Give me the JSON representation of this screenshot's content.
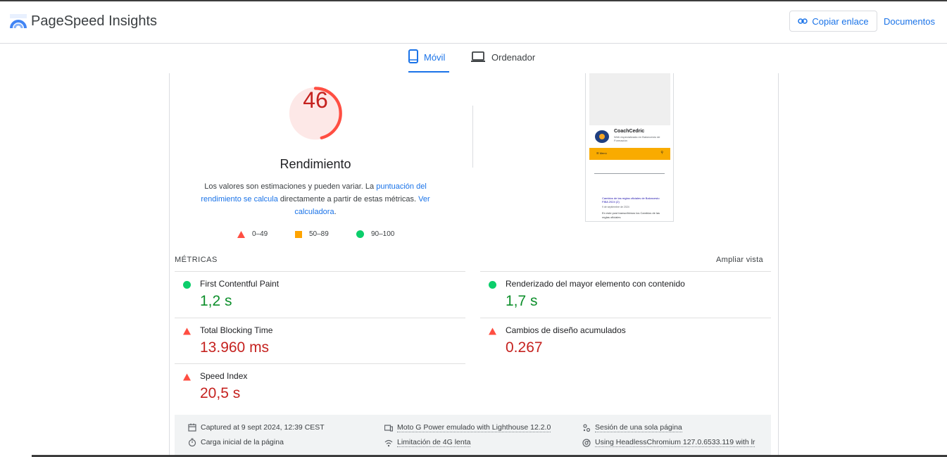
{
  "header": {
    "app_title": "PageSpeed Insights",
    "copy_link_label": "Copiar enlace",
    "docs_label": "Documentos"
  },
  "tabs": [
    {
      "label": "Móvil",
      "icon": "phone-icon",
      "selected": true
    },
    {
      "label": "Ordenador",
      "icon": "laptop-icon",
      "selected": false
    }
  ],
  "performance": {
    "score": "46",
    "score_fraction": 0.46,
    "title": "Rendimiento",
    "desc_prefix": "Los valores son estimaciones y pueden variar. La ",
    "desc_link1": "puntuación del rendimiento se calcula",
    "desc_middle": " directamente a partir de estas métricas. ",
    "desc_link2": "Ver calculadora",
    "desc_suffix": "."
  },
  "legend": [
    {
      "label": "0–49",
      "shape": "triangle",
      "color": "#ff4e42"
    },
    {
      "label": "50–89",
      "shape": "square",
      "color": "#ffa400"
    },
    {
      "label": "90–100",
      "shape": "circle",
      "color": "#0cce6b"
    }
  ],
  "screenshot": {
    "brand": "CoachCedric",
    "tagline": "Web especializada en Baloncesto de Formación",
    "menu_label": "☰ Menú",
    "post_title": "Cambios de las reglas oficiales de Baloncesto FIBA 2024 (2)",
    "post_date": "9 de septiembre de 2024",
    "post_excerpt": "En este post transcribimos los Cambios de las reglas oficiales"
  },
  "metrics": {
    "section_title": "MÉTRICAS",
    "expand_label": "Ampliar vista",
    "items": [
      {
        "name": "First Contentful Paint",
        "value": "1,2 s",
        "status": "good"
      },
      {
        "name": "Renderizado del mayor elemento con contenido",
        "value": "1,7 s",
        "status": "good"
      },
      {
        "name": "Total Blocking Time",
        "value": "13.960 ms",
        "status": "bad"
      },
      {
        "name": "Cambios de diseño acumulados",
        "value": "0.267",
        "status": "bad"
      },
      {
        "name": "Speed Index",
        "value": "20,5 s",
        "status": "bad"
      }
    ]
  },
  "environment": [
    {
      "text": "Captured at 9 sept 2024, 12:39 CEST",
      "icon": "calendar-icon"
    },
    {
      "text": "Moto G Power emulado with Lighthouse 12.2.0",
      "icon": "device-icon"
    },
    {
      "text": "Sesión de una sola página",
      "icon": "users-icon"
    },
    {
      "text": "Carga inicial de la página",
      "icon": "timer-icon"
    },
    {
      "text": "Limitación de 4G lenta",
      "icon": "network-icon"
    },
    {
      "text": "Using HeadlessChromium 127.0.6533.119 with lr",
      "icon": "chrome-icon"
    }
  ],
  "colors": {
    "accent": "#1a73e8",
    "fail": "#ff4e42",
    "fail_text": "#c5221f",
    "pass": "#0cce6b",
    "pass_text": "#0d8f2b",
    "average": "#ffa400"
  }
}
